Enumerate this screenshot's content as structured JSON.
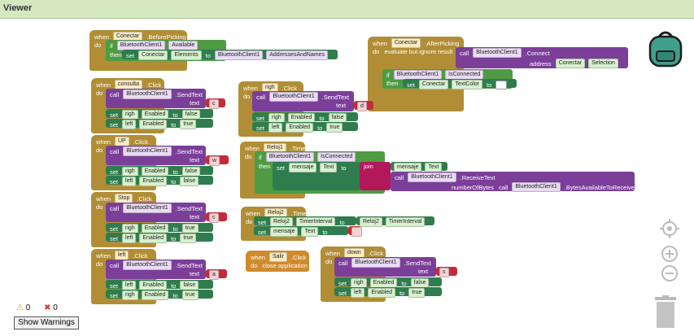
{
  "viewer": {
    "title": "Viewer"
  },
  "blocks": {
    "before_picking": {
      "event": "when",
      "comp": "Conectar",
      "evt": ".BeforePicking",
      "do": "do",
      "if_kw": "if",
      "cond_comp": "BluetoothClient1",
      "cond_prop": "Available",
      "then": "then",
      "set_kw": "set",
      "set_comp": "Conectar",
      "set_prop": "Elements",
      "to": "to",
      "val_comp": "BluetoothClient1",
      "val_prop": "AddressesAndNames"
    },
    "after_picking": {
      "event": "when",
      "comp": "Conectar",
      "evt": ".AfterPicking",
      "do": "do",
      "eval": "evaluate but ignore result",
      "call": "call",
      "call_comp": "BluetoothClient1",
      "call_method": ".Connect",
      "addr": "address",
      "addr_comp": "Conectar",
      "addr_prop": "Selection",
      "if_kw": "if",
      "cond_comp": "BluetoothClient1",
      "cond_prop": "IsConnected",
      "then": "then",
      "set_kw": "set",
      "set_comp": "Conectar",
      "set_prop": "TextColor",
      "to": "to"
    },
    "consulta": {
      "event": "when",
      "comp": "consulta",
      "evt": ".Click",
      "do": "do",
      "call": "call",
      "call_comp": "BluetoothClient1",
      "call_method": ".SendText",
      "text": "text",
      "text_val": "c",
      "s1_comp": "righ",
      "s1_prop": "Enabled",
      "s1_val": "false",
      "s2_comp": "left",
      "s2_prop": "Enabled",
      "s2_val": "true"
    },
    "righ": {
      "event": "when",
      "comp": "righ",
      "evt": ".Click",
      "do": "do",
      "call": "call",
      "call_comp": "BluetoothClient1",
      "call_method": ".SendText",
      "text": "text",
      "text_val": "d",
      "s1_comp": "righ",
      "s1_prop": "Enabled",
      "s1_val": "false",
      "s2_comp": "left",
      "s2_prop": "Enabled",
      "s2_val": "true"
    },
    "up": {
      "event": "when",
      "comp": "UP",
      "evt": ".Click",
      "do": "do",
      "call": "call",
      "call_comp": "BluetoothClient1",
      "call_method": ".SendText",
      "text": "text",
      "text_val": "w",
      "s1_comp": "righ",
      "s1_prop": "Enabled",
      "s1_val": "false",
      "s2_comp": "left",
      "s2_prop": "Enabled",
      "s2_val": "false"
    },
    "reloj1": {
      "event": "when",
      "comp": "Reloj1",
      "evt": ".Timer",
      "do": "do",
      "if_kw": "if",
      "cond_comp": "BluetoothClient1",
      "cond_prop": "IsConnected",
      "then": "then",
      "set_kw": "set",
      "set_comp": "mensaje",
      "set_prop": "Text",
      "to": "to",
      "join": "join",
      "j_comp": "mensaje",
      "j_prop": "Text",
      "call": "call",
      "call_comp": "BluetoothClient1",
      "call_method": ".ReceiveText",
      "nb": "numberOfBytes",
      "nb_comp": "BluetoothClient1",
      "nb_prop": ".BytesAvailableToReceive"
    },
    "stop": {
      "event": "when",
      "comp": "Stop",
      "evt": ".Click",
      "do": "do",
      "call": "call",
      "call_comp": "BluetoothClient1",
      "call_method": ".SendText",
      "text": "text",
      "text_val": "c",
      "s1_comp": "righ",
      "s1_prop": "Enabled",
      "s1_val": "true",
      "s2_comp": "left",
      "s2_prop": "Enabled",
      "s2_val": "true"
    },
    "reloj2": {
      "event": "when",
      "comp": "Reloj2",
      "evt": ".Timer",
      "do": "do",
      "s1_kw": "set",
      "s1_comp": "Reloj2",
      "s1_prop": "TimerInterval",
      "to": "to",
      "s1_val_comp": "Reloj2",
      "s1_val_prop": "TimerInterval",
      "s2_kw": "set",
      "s2_comp": "mensaje",
      "s2_prop": "Text",
      "s2_val": ""
    },
    "left": {
      "event": "when",
      "comp": "left",
      "evt": ".Click",
      "do": "do",
      "call": "call",
      "call_comp": "BluetoothClient1",
      "call_method": ".SendText",
      "text": "text",
      "text_val": "a",
      "s1_comp": "left",
      "s1_prop": "Enabled",
      "s1_val": "false",
      "s2_comp": "righ",
      "s2_prop": "Enabled",
      "s2_val": "true"
    },
    "salir": {
      "event": "when",
      "comp": "Salir",
      "evt": ".Click",
      "do": "do",
      "action": "close application"
    },
    "down": {
      "event": "when",
      "comp": "down",
      "evt": ".Click",
      "do": "do",
      "call": "call",
      "call_comp": "BluetoothClient1",
      "call_method": ".SendText",
      "text": "text",
      "text_val": "s",
      "s1_comp": "righ",
      "s1_prop": "Enabled",
      "s1_val": "false",
      "s2_comp": "left",
      "s2_prop": "Enabled",
      "s2_val": "true"
    }
  },
  "warnings": {
    "warn_count": "0",
    "error_count": "0",
    "button": "Show Warnings"
  },
  "icons": {
    "backpack": "backpack-icon",
    "target": "target-icon",
    "zoom_in": "zoom-in-icon",
    "zoom_out": "zoom-out-icon",
    "trash": "trash-icon"
  },
  "colors": {
    "event": "#b18e35",
    "call": "#7b3f99",
    "setter": "#2f7d4e",
    "logic": "#4e9b43",
    "text": "#c52a3a"
  }
}
